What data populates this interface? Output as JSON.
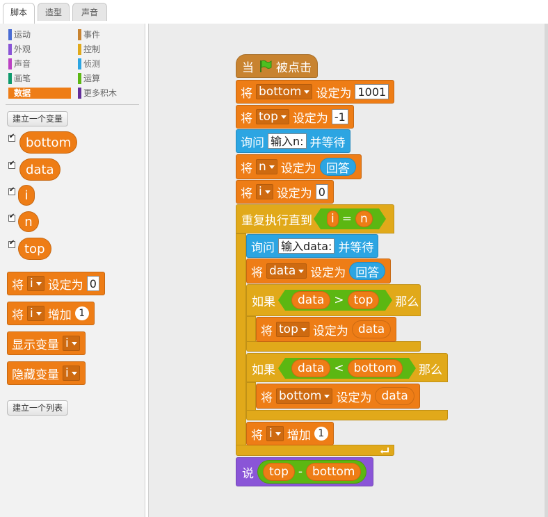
{
  "tabs": [
    "脚本",
    "造型",
    "声音"
  ],
  "categories": [
    {
      "label": "运动",
      "color": "#4a6cd4"
    },
    {
      "label": "事件",
      "color": "#c88330"
    },
    {
      "label": "外观",
      "color": "#8a55d7"
    },
    {
      "label": "控制",
      "color": "#e1a91a"
    },
    {
      "label": "声音",
      "color": "#bb42c3"
    },
    {
      "label": "侦测",
      "color": "#2ca5e2"
    },
    {
      "label": "画笔",
      "color": "#0e9a6c"
    },
    {
      "label": "运算",
      "color": "#5cb712"
    },
    {
      "label": "数据",
      "color": "#ee7d16"
    },
    {
      "label": "更多积木",
      "color": "#632d99"
    }
  ],
  "palette": {
    "make_variable": "建立一个变量",
    "make_list": "建立一个列表",
    "variables": [
      "bottom",
      "data",
      "i",
      "n",
      "top"
    ],
    "set_label": "将",
    "set_mid": "设定为",
    "set_var": "i",
    "set_value": "0",
    "change_label": "将",
    "change_mid": "增加",
    "change_var": "i",
    "change_value": "1",
    "show_label": "显示变量",
    "show_var": "i",
    "hide_label": "隐藏变量",
    "hide_var": "i"
  },
  "script": {
    "hat": {
      "when": "当",
      "clicked": "被点击"
    },
    "set_word": "将",
    "set_to": "设定为",
    "set_bottom": {
      "var": "bottom",
      "value": "1001"
    },
    "set_top": {
      "var": "top",
      "value": "-1"
    },
    "ask1": {
      "ask": "询问",
      "prompt": "输入n:",
      "wait": "并等待"
    },
    "set_n": {
      "var": "n",
      "value": "回答"
    },
    "set_i": {
      "var": "i",
      "value": "0"
    },
    "repeat_until": {
      "label": "重复执行直到",
      "left": "i",
      "op": "=",
      "right": "n"
    },
    "ask2": {
      "ask": "询问",
      "prompt": "输入data:",
      "wait": "并等待"
    },
    "set_data": {
      "var": "data",
      "value": "回答"
    },
    "if1": {
      "if": "如果",
      "left": "data",
      "op": ">",
      "right": "top",
      "then": "那么"
    },
    "set_top_data": {
      "var": "top",
      "value": "data"
    },
    "if2": {
      "if": "如果",
      "left": "data",
      "op": "<",
      "right": "bottom",
      "then": "那么"
    },
    "set_bottom_data": {
      "var": "bottom",
      "value": "data"
    },
    "change_i": {
      "word": "将",
      "var": "i",
      "mid": "增加",
      "value": "1"
    },
    "say": {
      "word": "说",
      "left": "top",
      "op": "-",
      "right": "bottom"
    }
  }
}
